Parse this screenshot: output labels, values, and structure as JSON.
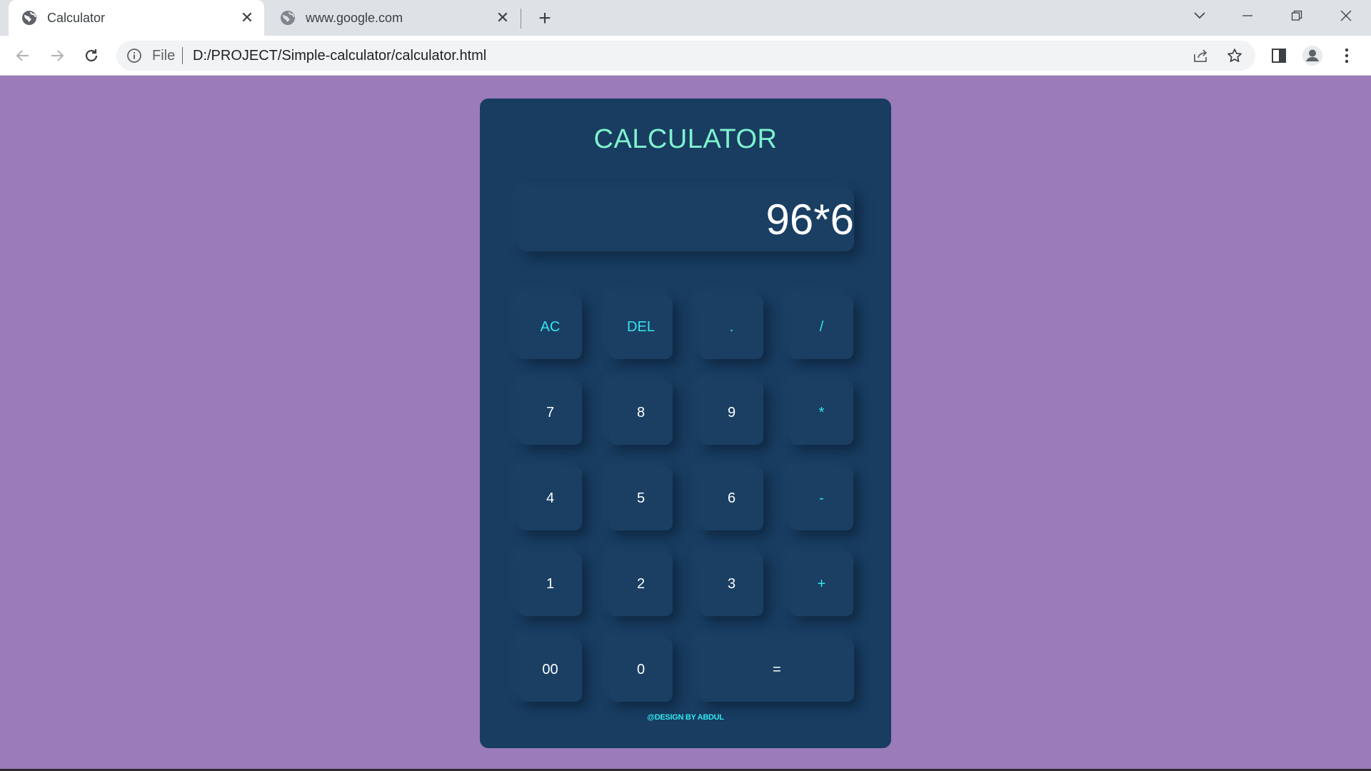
{
  "browser": {
    "tabs": [
      {
        "title": "Calculator",
        "icon": "globe-icon",
        "active": true
      },
      {
        "title": "www.google.com",
        "icon": "globe-icon",
        "active": false
      }
    ],
    "address": {
      "scheme_label": "File",
      "url": "D:/PROJECT/Simple-calculator/calculator.html"
    }
  },
  "page": {
    "background_color": "#9b7bb9",
    "panel_color": "#183d61",
    "accent_title_color": "#7ff2cd",
    "accent_key_color": "#33e4f0"
  },
  "calculator": {
    "title": "CALCULATOR",
    "display": "96*6",
    "keys": [
      {
        "label": "AC",
        "kind": "op"
      },
      {
        "label": "DEL",
        "kind": "op"
      },
      {
        "label": ".",
        "kind": "op"
      },
      {
        "label": "/",
        "kind": "op"
      },
      {
        "label": "7",
        "kind": "num"
      },
      {
        "label": "8",
        "kind": "num"
      },
      {
        "label": "9",
        "kind": "num"
      },
      {
        "label": "*",
        "kind": "op"
      },
      {
        "label": "4",
        "kind": "num"
      },
      {
        "label": "5",
        "kind": "num"
      },
      {
        "label": "6",
        "kind": "num"
      },
      {
        "label": "-",
        "kind": "op"
      },
      {
        "label": "1",
        "kind": "num"
      },
      {
        "label": "2",
        "kind": "num"
      },
      {
        "label": "3",
        "kind": "num"
      },
      {
        "label": "+",
        "kind": "op"
      },
      {
        "label": "00",
        "kind": "num"
      },
      {
        "label": "0",
        "kind": "num"
      },
      {
        "label": "=",
        "kind": "num"
      }
    ],
    "credit": "@DESIGN BY ABDUL"
  }
}
